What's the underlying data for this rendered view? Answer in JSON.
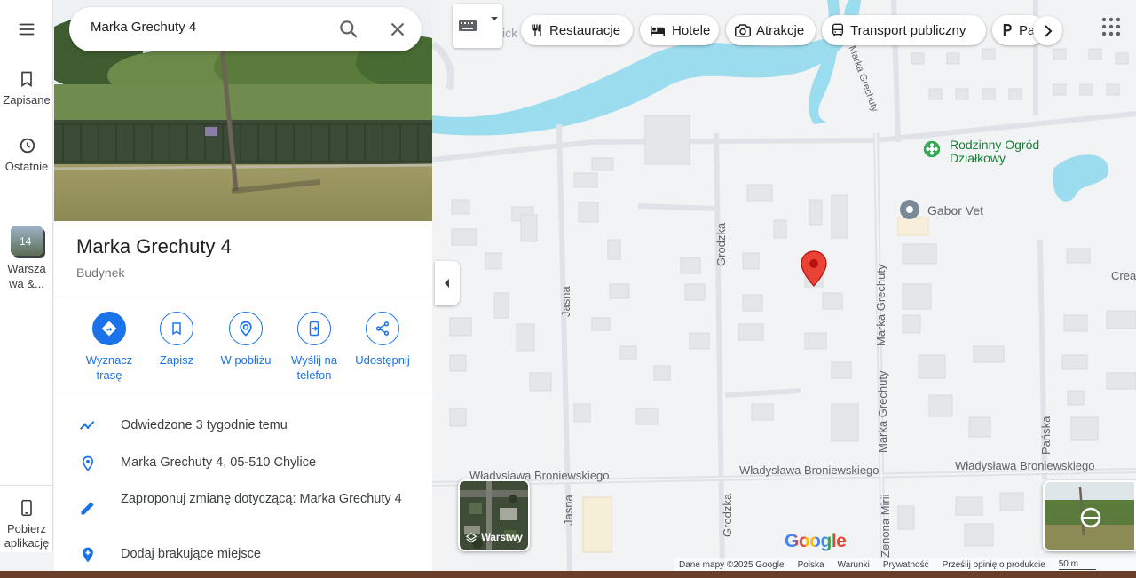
{
  "rail": {
    "saved_label": "Zapisane",
    "recent_label": "Ostatnie",
    "recent_place_badge": "14",
    "recent_place_label": "Warszawa &...",
    "get_app_label": "Pobierz aplikację"
  },
  "search": {
    "value": "Marka Grechuty 4"
  },
  "place": {
    "title": "Marka Grechuty 4",
    "type": "Budynek"
  },
  "actions": [
    {
      "label": "Wyznacz trasę",
      "icon": "directions-icon"
    },
    {
      "label": "Zapisz",
      "icon": "bookmark-icon"
    },
    {
      "label": "W pobliżu",
      "icon": "nearby-icon"
    },
    {
      "label": "Wyślij na telefon",
      "icon": "send-to-phone-icon"
    },
    {
      "label": "Udostępnij",
      "icon": "share-icon"
    }
  ],
  "info": {
    "visited": "Odwiedzone 3 tygodnie temu",
    "address": "Marka Grechuty 4, 05-510 Chylice",
    "suggest_edit": "Zaproponuj zmianę dotyczącą: Marka Grechuty 4",
    "add_missing": "Dodaj brakujące miejsce"
  },
  "chips": [
    {
      "label": "Restauracje",
      "icon": "restaurant-icon"
    },
    {
      "label": "Hotele",
      "icon": "hotel-icon"
    },
    {
      "label": "Atrakcje",
      "icon": "camera-icon"
    },
    {
      "label": "Transport publiczny",
      "icon": "transit-icon"
    },
    {
      "label": "Parkingi",
      "icon": "parking-icon"
    }
  ],
  "map": {
    "streets": {
      "grodzka": "Grodzka",
      "jasna": "Jasna",
      "marka_grechuty": "Marka Grechuty",
      "broniewskiego": "Władysława Broniewskiego",
      "panska": "Pańska",
      "zenona": "Zenona Mirii"
    },
    "pois": {
      "garden": "Rodzinny Ogród Działkowy",
      "vet": "Gabor Vet",
      "partial": "Crea"
    },
    "partial_top": "ick"
  },
  "layers": {
    "label": "Warstwy"
  },
  "google_logo": "Google",
  "footer": {
    "data": "Dane mapy ©2025 Google",
    "country": "Polska",
    "terms": "Warunki",
    "privacy": "Prywatność",
    "feedback": "Prześlij opinię o produkcie",
    "scale": "50 m"
  },
  "colors": {
    "accent": "#1a73e8",
    "water": "#9cdcef",
    "pin": "#ea4335",
    "poi_green": "#188038",
    "taskbar": "#6b3e2a"
  }
}
